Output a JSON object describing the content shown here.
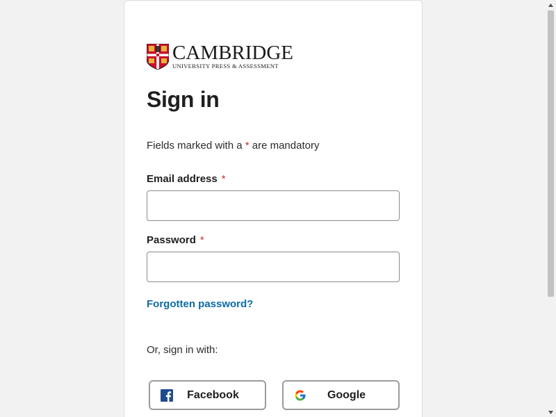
{
  "brand": {
    "name": "CAMBRIDGE",
    "tagline": "UNIVERSITY PRESS & ASSESSMENT",
    "shield_icon": "cambridge-shield-icon"
  },
  "page": {
    "title": "Sign in",
    "mandatory_prefix": "Fields marked with a",
    "mandatory_star": "*",
    "mandatory_suffix": "are mandatory"
  },
  "form": {
    "email_label": "Email address",
    "email_required": "*",
    "email_value": "",
    "password_label": "Password",
    "password_required": "*",
    "password_value": "",
    "forgot_link": "Forgotten password?"
  },
  "social": {
    "intro": "Or, sign in with:",
    "buttons": [
      {
        "label": "Facebook",
        "icon": "facebook-icon"
      },
      {
        "label": "Google",
        "icon": "google-icon"
      }
    ]
  },
  "colors": {
    "required": "#d22e2e",
    "link": "#0b6aa6",
    "background": "#f2f2f2"
  }
}
